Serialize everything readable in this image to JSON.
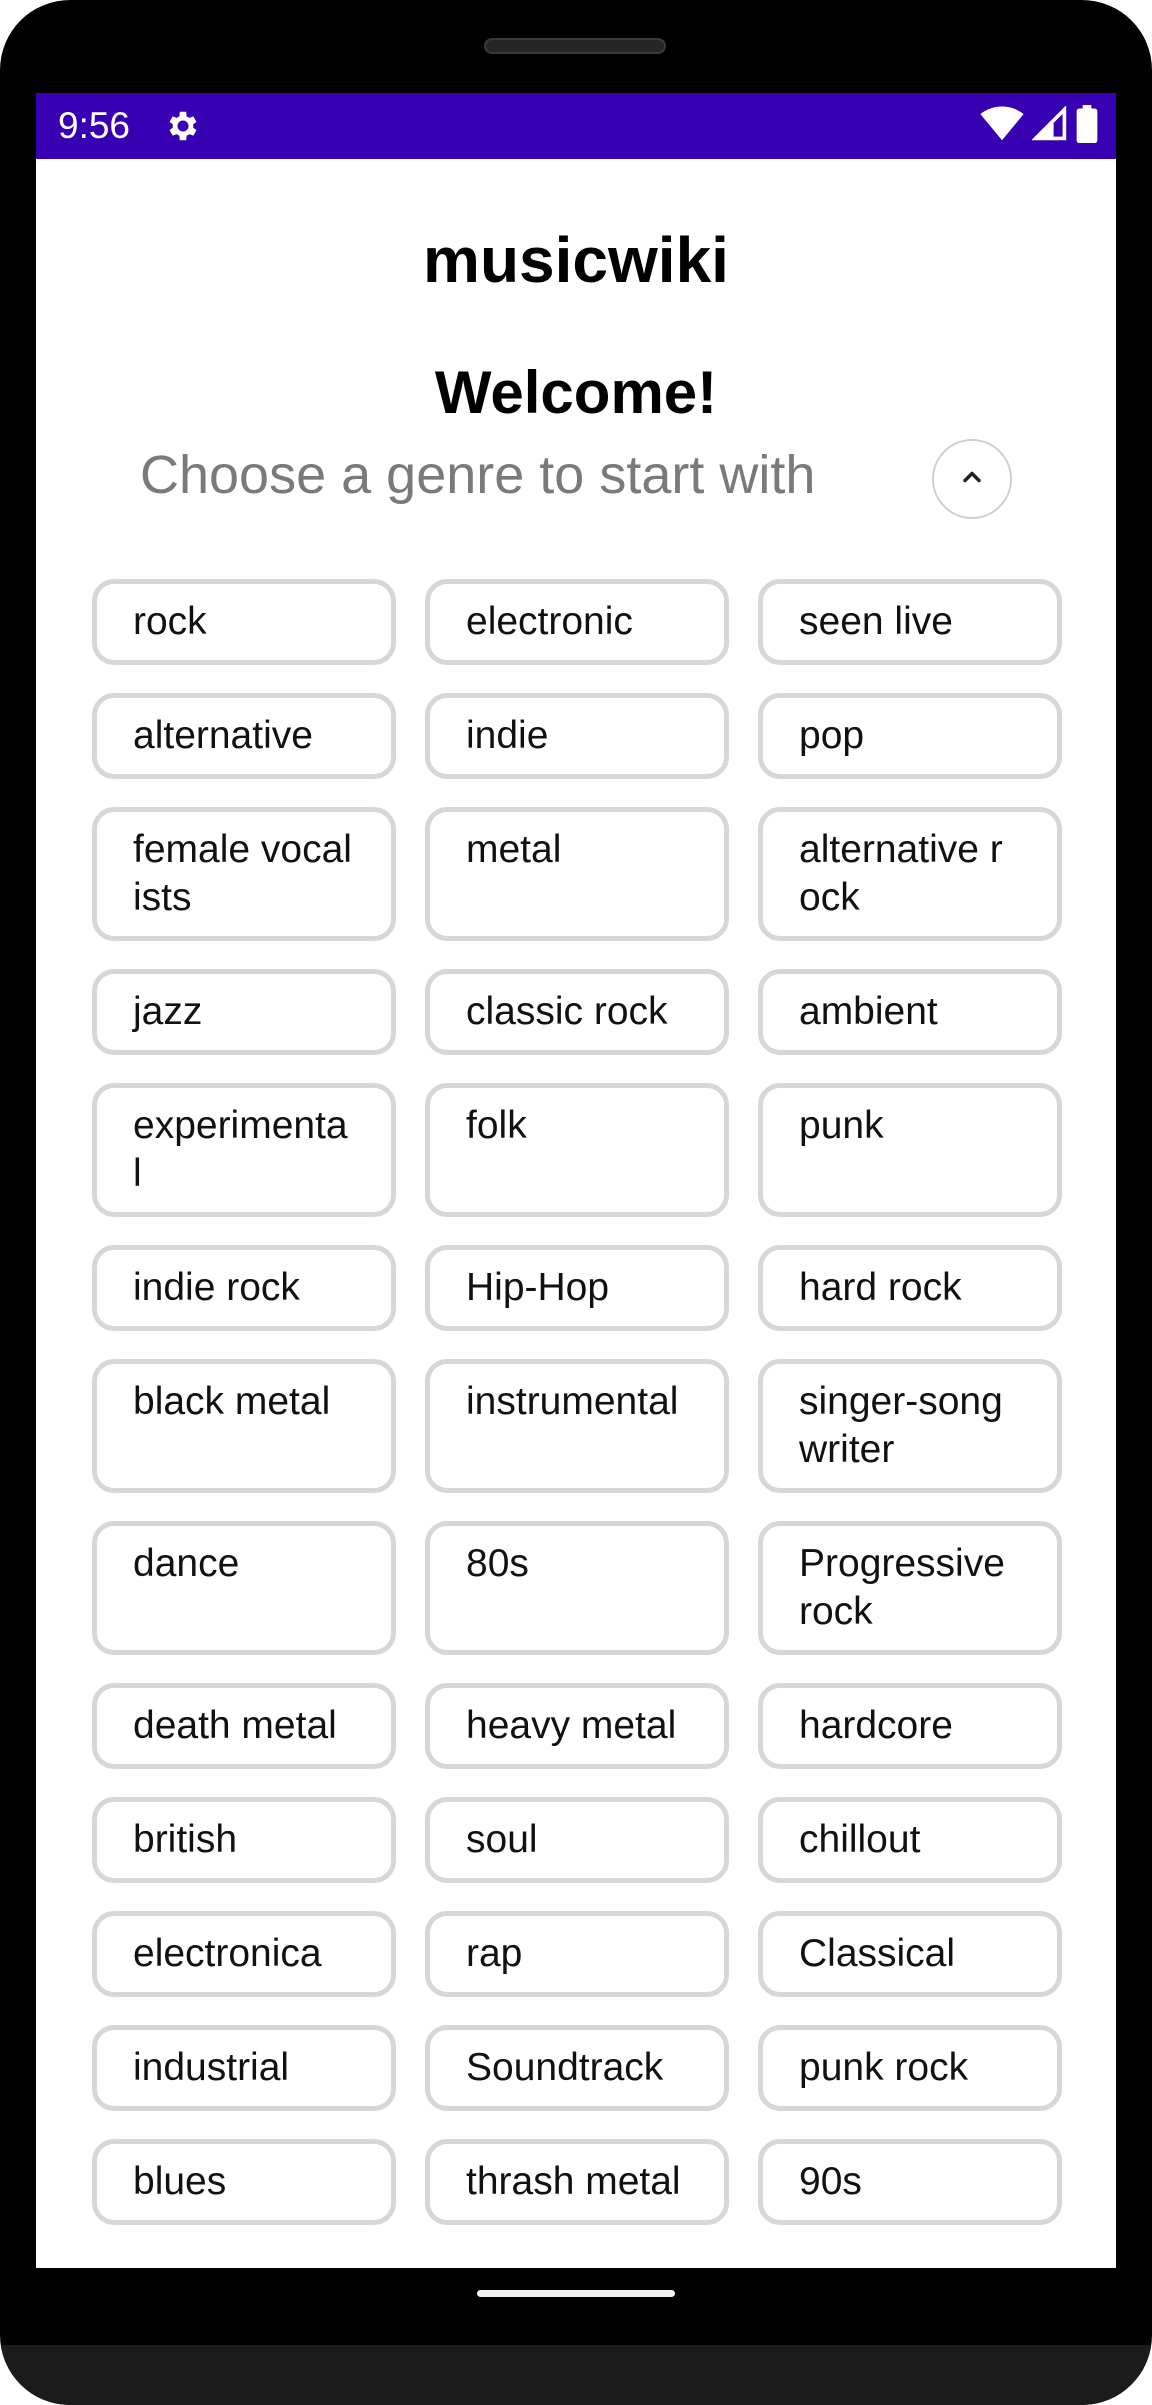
{
  "status_bar": {
    "time": "9:56",
    "background": "#3700b3"
  },
  "app": {
    "title": "musicwiki",
    "welcome": "Welcome!",
    "subtitle": "Choose a genre to start with"
  },
  "genres": [
    "rock",
    "electronic",
    "seen live",
    "alternative",
    "indie",
    "pop",
    "female vocalists",
    "metal",
    "alternative rock",
    "jazz",
    "classic rock",
    "ambient",
    "experimental",
    "folk",
    "punk",
    "indie rock",
    "Hip-Hop",
    "hard rock",
    "black metal",
    "instrumental",
    "singer-songwriter",
    "dance",
    "80s",
    "Progressive rock",
    "death metal",
    "heavy metal",
    "hardcore",
    "british",
    "soul",
    "chillout",
    "electronica",
    "rap",
    "Classical",
    "industrial",
    "Soundtrack",
    "punk rock",
    "blues",
    "thrash metal",
    "90s"
  ],
  "icons": {
    "settings": "gear-icon",
    "wifi": "wifi-icon",
    "signal": "signal-icon",
    "battery": "battery-icon",
    "collapse": "chevron-up-icon"
  }
}
